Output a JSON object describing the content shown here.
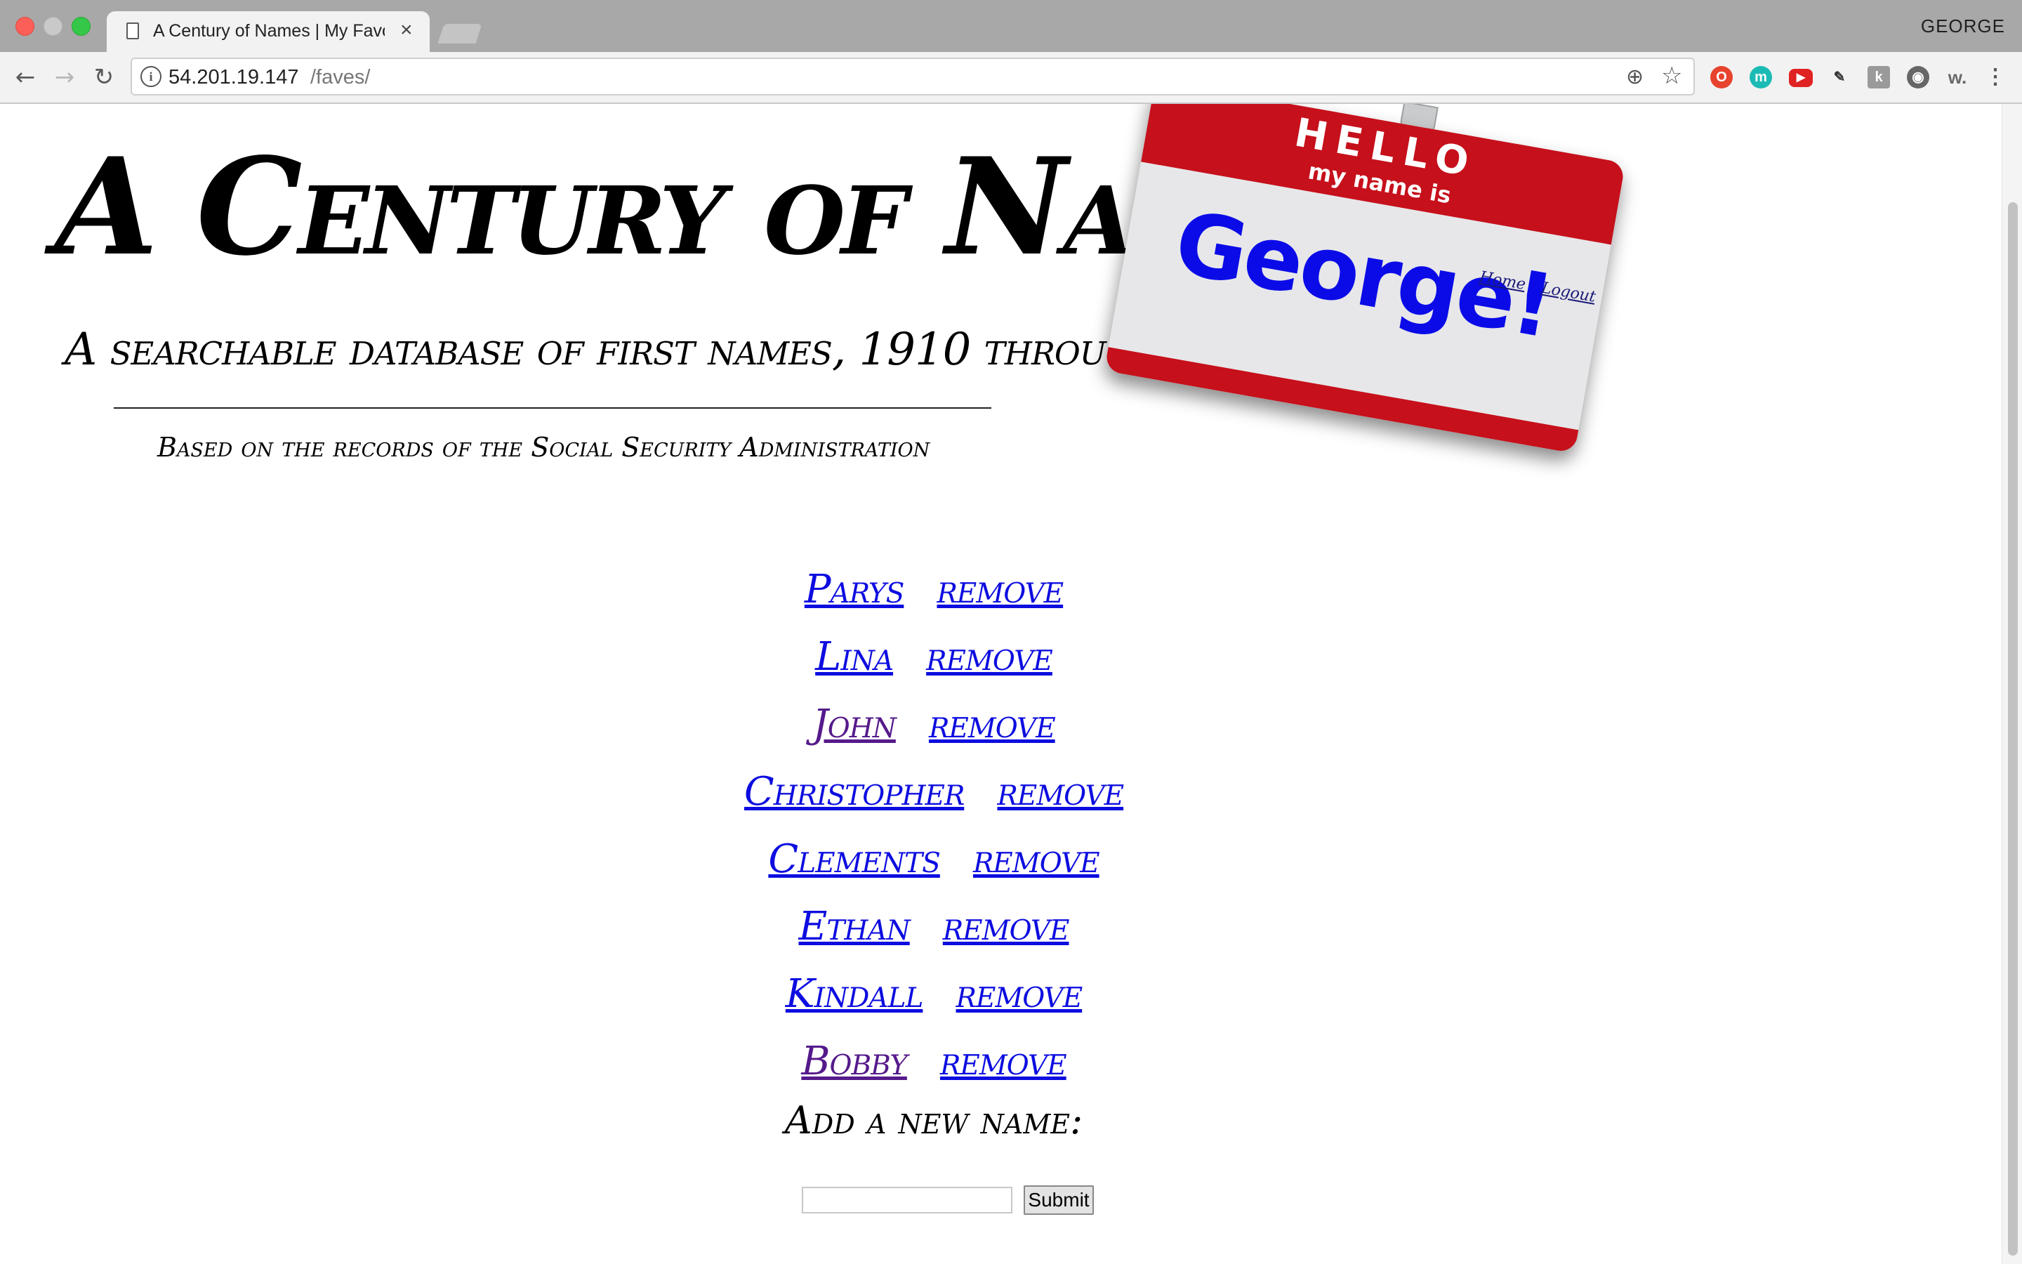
{
  "browser": {
    "tab_title": "A Century of Names | My Favo",
    "tab_close": "×",
    "profile": "GEORGE",
    "url_host": "54.201.19.147",
    "url_path": "/faves/",
    "buttons": {
      "back": "←",
      "forward": "→",
      "reload": "↻"
    }
  },
  "header": {
    "title": "A Century of Names",
    "subtitle": "A searchable database of first names, 1910 through 2015",
    "source": "Based on the records of the Social Security Administration"
  },
  "badge": {
    "hello": "HELLO",
    "my_name_is": "my name is",
    "name": "George!",
    "links": {
      "home": "Home",
      "logout": "Logout"
    }
  },
  "favorites": [
    {
      "name": "Parys",
      "remove": "remove",
      "visited": false
    },
    {
      "name": "Lina",
      "remove": "remove",
      "visited": false
    },
    {
      "name": "John",
      "remove": "remove",
      "visited": true
    },
    {
      "name": "Christopher",
      "remove": "remove",
      "visited": false
    },
    {
      "name": "Clements",
      "remove": "remove",
      "visited": false
    },
    {
      "name": "Ethan",
      "remove": "remove",
      "visited": false
    },
    {
      "name": "Kindall",
      "remove": "remove",
      "visited": false
    },
    {
      "name": "Bobby",
      "remove": "remove",
      "visited": true
    }
  ],
  "add_form": {
    "heading": "Add a new name:",
    "input_value": "",
    "submit_label": "Submit"
  },
  "colors": {
    "link": "#0d0de0",
    "visited_link": "#551a8b",
    "badge_red": "#c6101b",
    "badge_name": "#0b0be8"
  }
}
